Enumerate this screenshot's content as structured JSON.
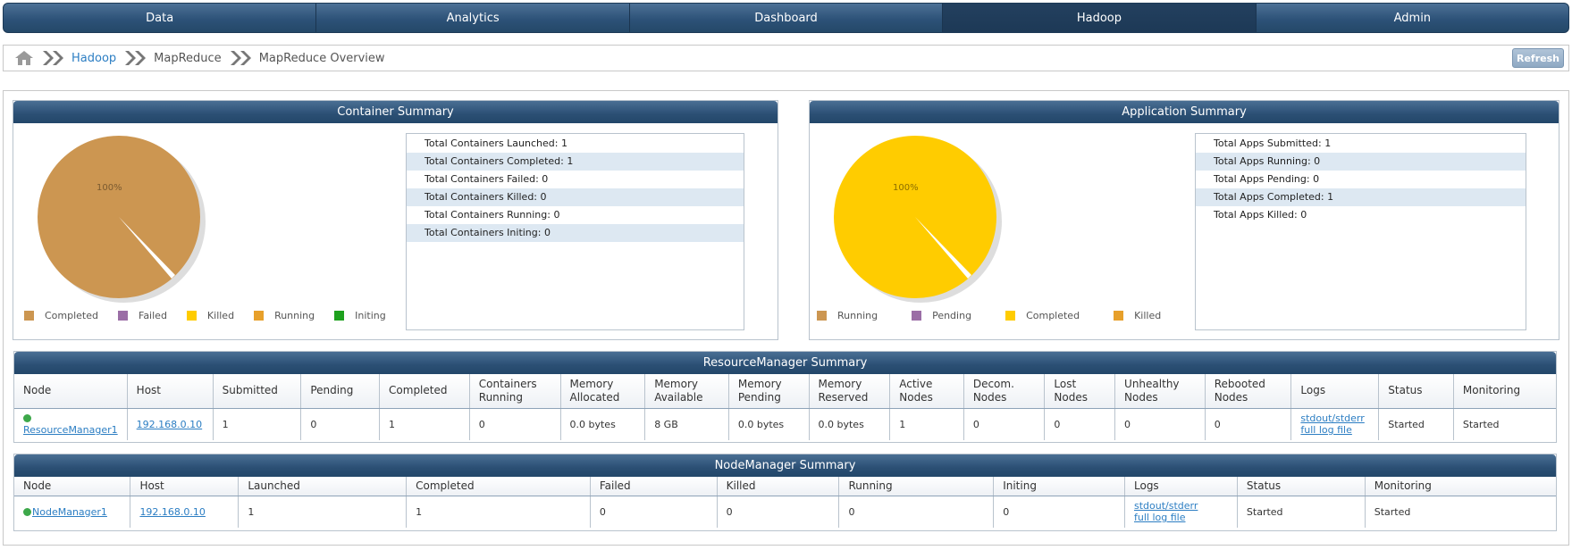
{
  "nav": {
    "tabs": [
      {
        "label": "Data"
      },
      {
        "label": "Analytics"
      },
      {
        "label": "Dashboard"
      },
      {
        "label": "Hadoop"
      },
      {
        "label": "Admin"
      }
    ],
    "active": "Hadoop"
  },
  "breadcrumb": {
    "items": [
      "Hadoop",
      "MapReduce",
      "MapReduce Overview"
    ],
    "refresh_label": "Refresh"
  },
  "container_summary": {
    "title": "Container Summary",
    "pie_label": "100%",
    "legend": [
      {
        "label": "Completed",
        "color": "#cc9651"
      },
      {
        "label": "Failed",
        "color": "#9b6ea6"
      },
      {
        "label": "Killed",
        "color": "#ffcc00"
      },
      {
        "label": "Running",
        "color": "#e7a02b"
      },
      {
        "label": "Initing",
        "color": "#1ea11e"
      }
    ],
    "stats": [
      "Total Containers Launched: 1",
      "Total Containers Completed: 1",
      "Total Containers Failed: 0",
      "Total Containers Killed: 0",
      "Total Containers Running: 0",
      "Total Containers Initing: 0"
    ]
  },
  "application_summary": {
    "title": "Application Summary",
    "pie_label": "100%",
    "legend": [
      {
        "label": "Running",
        "color": "#cc9651"
      },
      {
        "label": "Pending",
        "color": "#9b6ea6"
      },
      {
        "label": "Completed",
        "color": "#ffcc00"
      },
      {
        "label": "Killed",
        "color": "#e7a02b"
      }
    ],
    "stats": [
      "Total Apps Submitted: 1",
      "Total Apps Running: 0",
      "Total Apps Pending: 0",
      "Total Apps Completed: 1",
      "Total Apps Killed: 0"
    ]
  },
  "resource_manager": {
    "title": "ResourceManager Summary",
    "headers": [
      "Node",
      "Host",
      "Submitted",
      "Pending",
      "Completed",
      "Containers Running",
      "Memory Allocated",
      "Memory Available",
      "Memory Pending",
      "Memory Reserved",
      "Active Nodes",
      "Decom. Nodes",
      "Lost Nodes",
      "Unhealthy Nodes",
      "Rebooted Nodes",
      "Logs",
      "Status",
      "Monitoring"
    ],
    "row": {
      "node": "ResourceManager1",
      "host": "192.168.0.10",
      "submitted": "1",
      "pending": "0",
      "completed": "1",
      "containers_running": "0",
      "memory_allocated": "0.0 bytes",
      "memory_available": "8 GB",
      "memory_pending": "0.0 bytes",
      "memory_reserved": "0.0 bytes",
      "active_nodes": "1",
      "decom_nodes": "0",
      "lost_nodes": "0",
      "unhealthy_nodes": "0",
      "rebooted_nodes": "0",
      "log_stdout": "stdout/stderr",
      "log_full": "full log file",
      "status": "Started",
      "monitoring": "Started"
    }
  },
  "node_manager": {
    "title": "NodeManager Summary",
    "headers": [
      "Node",
      "Host",
      "Launched",
      "Completed",
      "Failed",
      "Killed",
      "Running",
      "Initing",
      "Logs",
      "Status",
      "Monitoring"
    ],
    "row": {
      "node": "NodeManager1",
      "host": "192.168.0.10",
      "launched": "1",
      "completed": "1",
      "failed": "0",
      "killed": "0",
      "running": "0",
      "initing": "0",
      "log_stdout": "stdout/stderr",
      "log_full": "full log file",
      "status": "Started",
      "monitoring": "Started"
    }
  }
}
